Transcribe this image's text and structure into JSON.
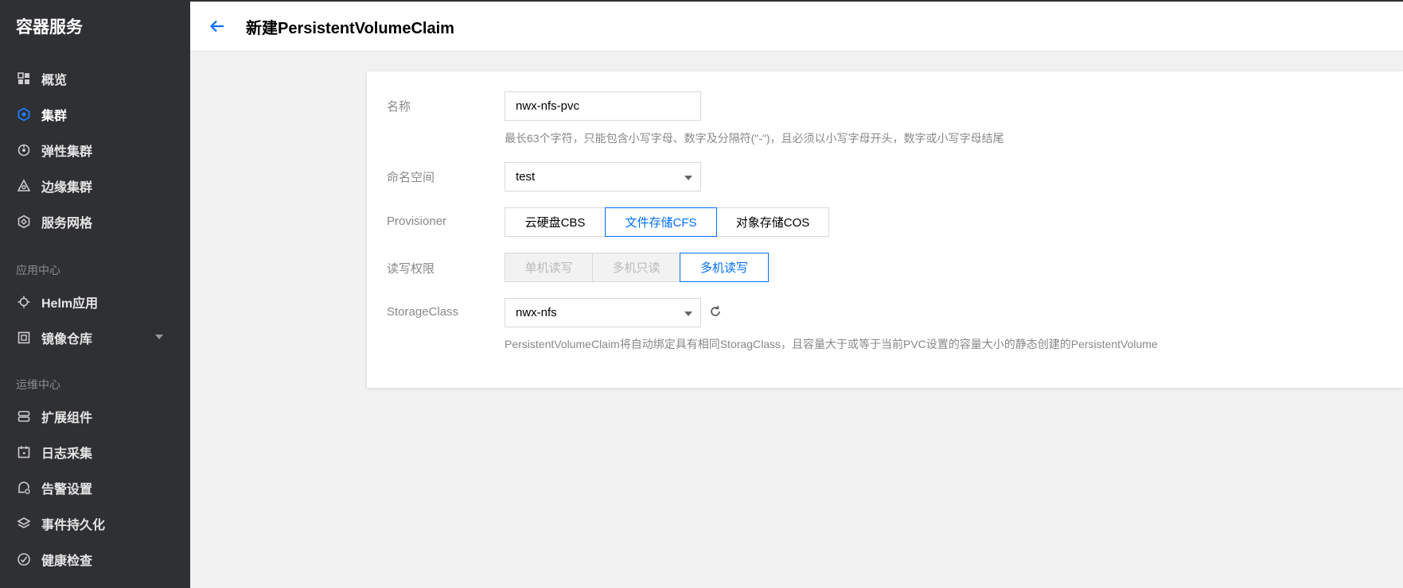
{
  "sidebar": {
    "brand": "容器服务",
    "items": [
      {
        "label": "概览",
        "icon": "grid-icon"
      },
      {
        "label": "集群",
        "icon": "cluster-icon",
        "active": true
      },
      {
        "label": "弹性集群",
        "icon": "elastic-cluster-icon"
      },
      {
        "label": "边缘集群",
        "icon": "edge-cluster-icon"
      },
      {
        "label": "服务网格",
        "icon": "mesh-icon"
      }
    ],
    "group_app": "应用中心",
    "app_items": [
      {
        "label": "Helm应用",
        "icon": "helm-icon"
      },
      {
        "label": "镜像仓库",
        "icon": "registry-icon"
      }
    ],
    "group_ops": "运维中心",
    "ops_items": [
      {
        "label": "扩展组件",
        "icon": "addon-icon"
      },
      {
        "label": "日志采集",
        "icon": "calendar-icon"
      },
      {
        "label": "告警设置",
        "icon": "alarm-icon"
      },
      {
        "label": "事件持久化",
        "icon": "layers-icon"
      },
      {
        "label": "健康检查",
        "icon": "health-icon"
      }
    ]
  },
  "header": {
    "title": "新建PersistentVolumeClaim",
    "back_icon": "back-arrow-icon"
  },
  "form": {
    "name_label": "名称",
    "name_value": "nwx-nfs-pvc",
    "name_hint": "最长63个字符，只能包含小写字母、数字及分隔符(\"-\")，且必须以小写字母开头，数字或小写字母结尾",
    "namespace_label": "命名空间",
    "namespace_value": "test",
    "provisioner_label": "Provisioner",
    "provisioner_options": [
      "云硬盘CBS",
      "文件存储CFS",
      "对象存储COS"
    ],
    "provisioner_selected": "文件存储CFS",
    "access_label": "读写权限",
    "access_options": [
      "单机读写",
      "多机只读",
      "多机读写"
    ],
    "access_selected": "多机读写",
    "storageclass_label": "StorageClass",
    "storageclass_value": "nwx-nfs",
    "storageclass_hint": "PersistentVolumeClaim将自动绑定具有相同StoragClass，且容量大于或等于当前PVC设置的容量大小的静态创建的PersistentVolume"
  },
  "colors": {
    "sidebar_bg": "#2f3033",
    "accent": "#006eff",
    "page_bg": "#f2f2f2"
  }
}
